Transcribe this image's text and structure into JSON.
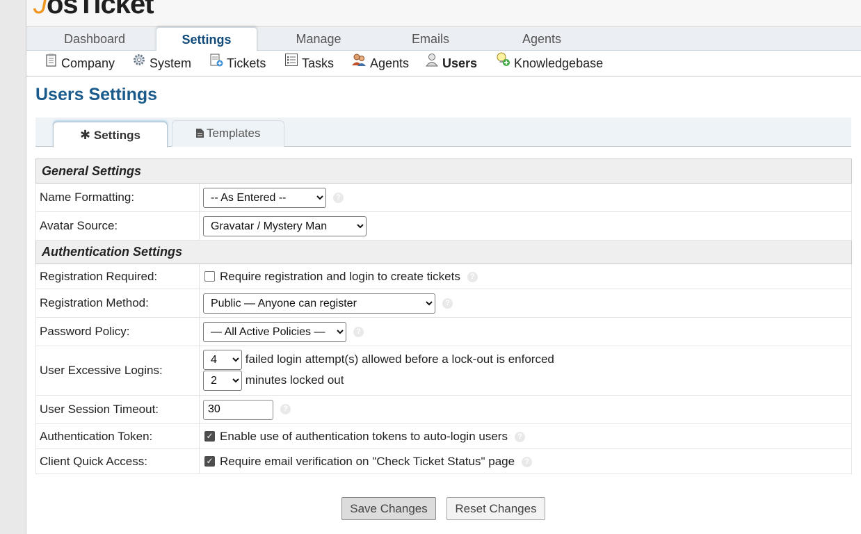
{
  "logo": {
    "text": "osTicket"
  },
  "main_nav": [
    {
      "label": "Dashboard"
    },
    {
      "label": "Settings"
    },
    {
      "label": "Manage"
    },
    {
      "label": "Emails"
    },
    {
      "label": "Agents"
    }
  ],
  "sub_nav": [
    {
      "label": "Company",
      "icon": "company-icon"
    },
    {
      "label": "System",
      "icon": "gear-icon"
    },
    {
      "label": "Tickets",
      "icon": "ticket-icon"
    },
    {
      "label": "Tasks",
      "icon": "tasks-icon"
    },
    {
      "label": "Agents",
      "icon": "agents-icon"
    },
    {
      "label": "Users",
      "icon": "user-icon"
    },
    {
      "label": "Knowledgebase",
      "icon": "knowledgebase-icon"
    }
  ],
  "page_title": "Users Settings",
  "tabs": [
    {
      "label": "Settings",
      "icon": "asterisk-icon"
    },
    {
      "label": "Templates",
      "icon": "document-icon"
    }
  ],
  "sections": {
    "general": "General Settings",
    "auth": "Authentication Settings"
  },
  "fields": {
    "name_formatting": {
      "label": "Name Formatting:",
      "value": "-- As Entered --"
    },
    "avatar_source": {
      "label": "Avatar Source:",
      "value": "Gravatar / Mystery Man"
    },
    "registration_required": {
      "label": "Registration Required:",
      "text": "Require registration and login to create tickets",
      "checked": false
    },
    "registration_method": {
      "label": "Registration Method:",
      "value": "Public — Anyone can register"
    },
    "password_policy": {
      "label": "Password Policy:",
      "value": "— All Active Policies —"
    },
    "excessive_logins": {
      "label": "User Excessive Logins:",
      "attempts_value": "4",
      "attempts_text": "failed login attempt(s) allowed before a lock-out is enforced",
      "minutes_value": "2",
      "minutes_text": "minutes locked out"
    },
    "session_timeout": {
      "label": "User Session Timeout:",
      "value": "30"
    },
    "auth_token": {
      "label": "Authentication Token:",
      "text": "Enable use of authentication tokens to auto-login users",
      "checked": true
    },
    "client_quick_access": {
      "label": "Client Quick Access:",
      "text": "Require email verification on \"Check Ticket Status\" page",
      "checked": true
    }
  },
  "buttons": {
    "save": "Save Changes",
    "reset": "Reset Changes"
  },
  "colors": {
    "title": "#1a5b8c",
    "active_nav": "#114a7a",
    "logo_accent": "#f0961e"
  }
}
